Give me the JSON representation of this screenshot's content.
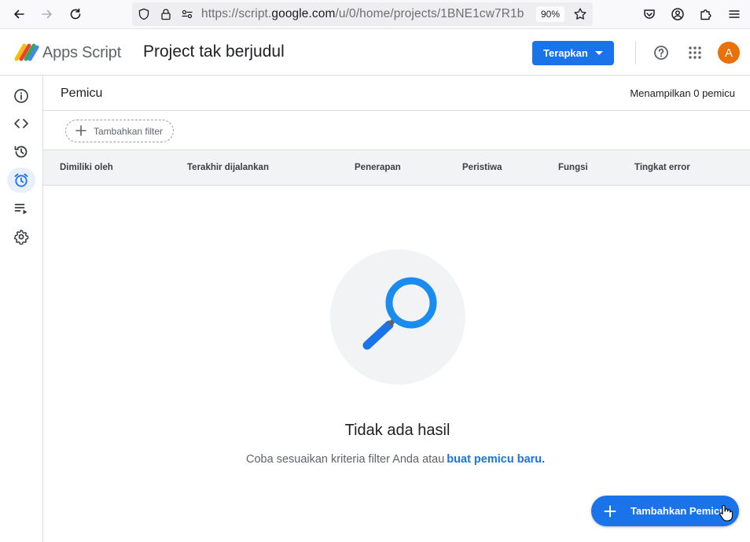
{
  "browser": {
    "url_prefix": "https://script.",
    "url_domain": "google.com",
    "url_path": "/u/0/home/projects/1BNE1cw7R1b",
    "zoom": "90%"
  },
  "header": {
    "brand": "Apps Script",
    "project_title": "Project tak berjudul",
    "deploy_label": "Terapkan",
    "avatar_initial": "A"
  },
  "colors": {
    "accent": "#1a73e8",
    "avatar": "#e8710a",
    "rail_active": "#e8f0fe"
  },
  "rail": {
    "items": [
      {
        "icon": "info-icon"
      },
      {
        "icon": "code-icon"
      },
      {
        "icon": "history-icon"
      },
      {
        "icon": "alarm-clock-icon",
        "active": true
      },
      {
        "icon": "executions-icon"
      },
      {
        "icon": "gear-icon"
      }
    ]
  },
  "main": {
    "title": "Pemicu",
    "count_text": "Menampilkan 0 pemicu",
    "filter_label": "Tambahkan filter",
    "columns": [
      "Dimiliki oleh",
      "Terakhir dijalankan",
      "Penerapan",
      "Peristiwa",
      "Fungsi",
      "Tingkat error"
    ],
    "empty_title": "Tidak ada hasil",
    "empty_desc": "Coba sesuaikan kriteria filter Anda atau",
    "empty_link": "buat pemicu baru.",
    "fab_label": "Tambahkan Pemicu"
  }
}
